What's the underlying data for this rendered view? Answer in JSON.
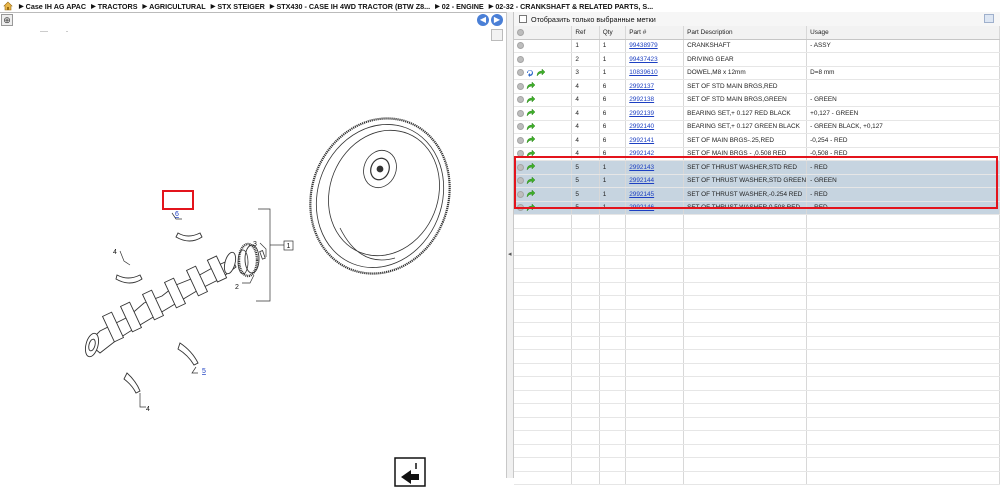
{
  "breadcrumb": {
    "items": [
      "Case IH AG APAC",
      "TRACTORS",
      "AGRICULTURAL",
      "STX STEIGER",
      "STX430 - CASE IH 4WD TRACTOR (BTW Z8...",
      "02 - ENGINE",
      "02-32 - CRANKSHAFT & RELATED PARTS, S..."
    ]
  },
  "diagram": {
    "callouts": {
      "c1": "1",
      "c2": "2",
      "c3": "3",
      "c4a": "4",
      "c4b": "4",
      "c5": "5",
      "c6": "6"
    }
  },
  "filter": {
    "label": "Отобразить только выбранные метки"
  },
  "table": {
    "headers": {
      "ref": "Ref",
      "qty": "Qty",
      "part": "Part #",
      "desc": "Part Description",
      "usage": "Usage"
    },
    "rows": [
      {
        "ref": "1",
        "qty": "1",
        "part": "99438979",
        "desc": "CRANKSHAFT",
        "usage": "- ASSY"
      },
      {
        "ref": "2",
        "qty": "1",
        "part": "99437423",
        "desc": "DRIVING GEAR",
        "usage": ""
      },
      {
        "ref": "3",
        "qty": "1",
        "part": "10839610",
        "desc": "DOWEL,M8 x 12mm",
        "usage": "D=8 mm"
      },
      {
        "ref": "4",
        "qty": "6",
        "part": "2992137",
        "desc": "SET OF STD MAIN BRGS,RED",
        "usage": ""
      },
      {
        "ref": "4",
        "qty": "6",
        "part": "2992138",
        "desc": "SET OF STD MAIN BRGS,GREEN",
        "usage": "- GREEN"
      },
      {
        "ref": "4",
        "qty": "6",
        "part": "2992139",
        "desc": "BEARING SET,+ 0.127 RED BLACK",
        "usage": "+0,127 - GREEN"
      },
      {
        "ref": "4",
        "qty": "6",
        "part": "2992140",
        "desc": "BEARING SET,+ 0.127 GREEN BLACK",
        "usage": "- GREEN BLACK, +0,127"
      },
      {
        "ref": "4",
        "qty": "6",
        "part": "2992141",
        "desc": "SET OF MAIN BRGS-.25,RED",
        "usage": "-0,254 - RED"
      },
      {
        "ref": "4",
        "qty": "6",
        "part": "2992142",
        "desc": "SET OF MAIN BRGS - ,0.508 RED",
        "usage": "-0,508 - RED"
      },
      {
        "ref": "5",
        "qty": "1",
        "part": "2992143",
        "desc": "SET OF THRUST WASHER,STD RED",
        "usage": "- RED"
      },
      {
        "ref": "5",
        "qty": "1",
        "part": "2992144",
        "desc": "SET OF THRUST WASHER,STD GREEN",
        "usage": "- GREEN"
      },
      {
        "ref": "5",
        "qty": "1",
        "part": "2992145",
        "desc": "SET OF THRUST WASHER,-0.254 RED",
        "usage": "- RED"
      },
      {
        "ref": "5",
        "qty": "1",
        "part": "2992146",
        "desc": "SET OF THRUST WASHER,0.508 RED",
        "usage": "- RED"
      }
    ]
  },
  "colors": {
    "highlight_border": "#e3141c",
    "selected_row": "#c6d4e0",
    "link": "#1c3fc2",
    "nav_button": "#4a7fd6",
    "green_arrow": "#3fae2a"
  },
  "icons": {
    "breadcrumb_home": "home-icon",
    "row_action": "circle-icon",
    "go_to_part": "green-arrow-icon",
    "replace": "blue-arrow-icon",
    "diagram_nav_prev": "arrow-left-icon",
    "diagram_nav_next": "arrow-right-icon",
    "export": "export-icon"
  }
}
